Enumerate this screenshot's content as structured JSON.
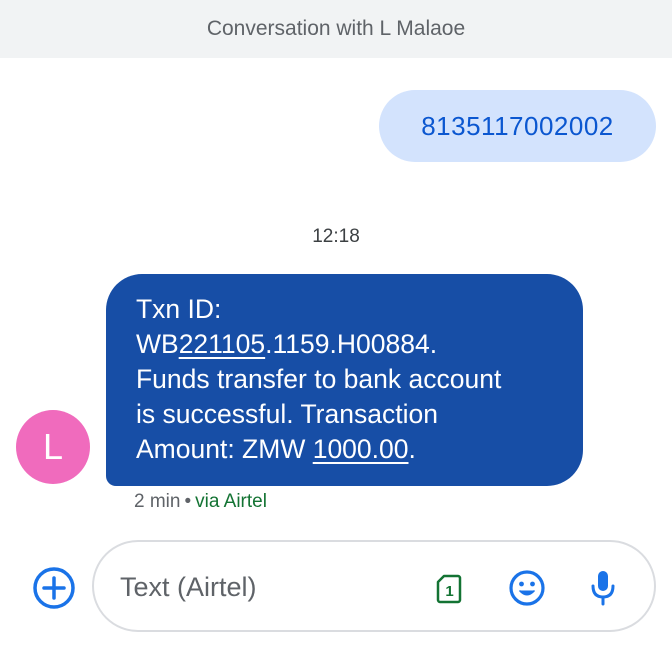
{
  "header": {
    "title": "Conversation with L Malaoe"
  },
  "sent_message": {
    "text": "8135117002002"
  },
  "timestamp": "12:18",
  "contact": {
    "initial": "L",
    "avatar_color": "#f06bbd"
  },
  "received_message": {
    "line1": "Txn ID:",
    "line2_prefix": "WB",
    "line2_link": "221105",
    "line2_suffix": ".1159.H00884.",
    "line3": "Funds transfer to bank account",
    "line4": "is successful. Transaction",
    "line5_prefix": "Amount: ZMW ",
    "line5_link": "1000.00",
    "line5_suffix": "."
  },
  "message_meta": {
    "age": "2 min",
    "separator": "•",
    "via": "via Airtel"
  },
  "compose": {
    "placeholder": "Text (Airtel)",
    "value": ""
  },
  "icons": {
    "add": "add-circle-icon",
    "sim": "sim-card-1-icon",
    "sim_label": "1",
    "emoji": "emoji-icon",
    "mic": "microphone-icon"
  },
  "colors": {
    "header_bg": "#f1f3f4",
    "sent_bubble": "#d3e3fd",
    "sent_text": "#0b57d0",
    "received_bubble": "#174ea6",
    "accent_blue": "#1a73e8",
    "via_green": "#137333",
    "sim_green": "#137333"
  }
}
